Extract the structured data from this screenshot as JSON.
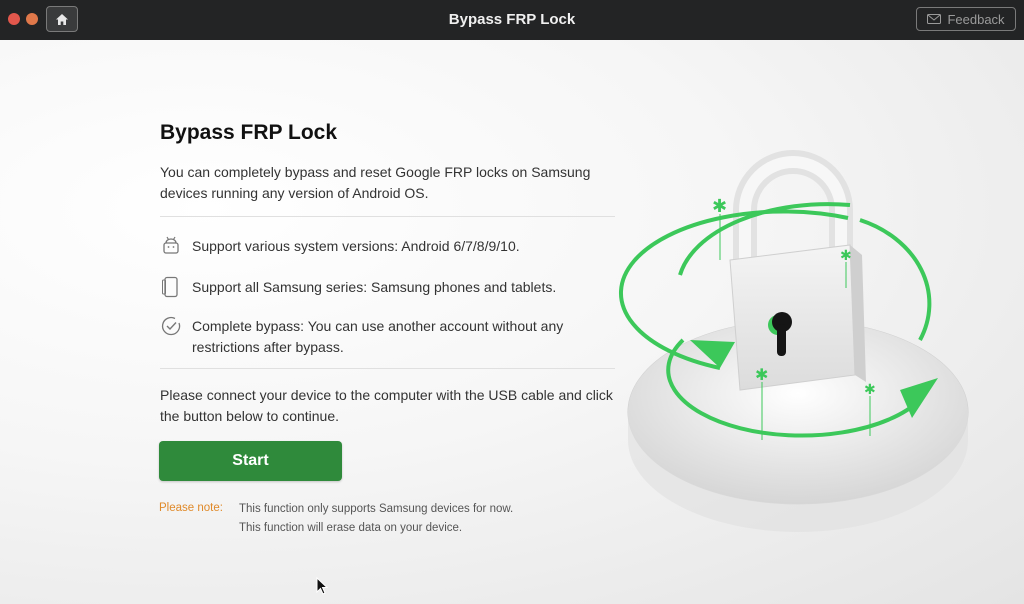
{
  "window": {
    "title": "Bypass FRP Lock",
    "feedback_label": "Feedback"
  },
  "main": {
    "heading": "Bypass FRP Lock",
    "description": "You can completely bypass and reset Google FRP locks on Samsung devices running any version of Android OS.",
    "features": [
      {
        "icon": "android-icon",
        "text": "Support various system versions: Android 6/7/8/9/10."
      },
      {
        "icon": "phone-icon",
        "text": "Support all Samsung series: Samsung phones and tablets."
      },
      {
        "icon": "checkmark-circle-icon",
        "text": "Complete bypass: You can use another account without any restrictions after bypass."
      }
    ],
    "instruction": "Please connect your device to the computer with the USB cable and click the button below to continue.",
    "start_label": "Start",
    "note_label": "Please note:",
    "note_lines": [
      "This function only supports Samsung devices for now.",
      "This function will erase data on your device."
    ]
  },
  "colors": {
    "accent": "#2f8a3b",
    "note": "#e08a2a",
    "illustration_green": "#3cc85a"
  }
}
